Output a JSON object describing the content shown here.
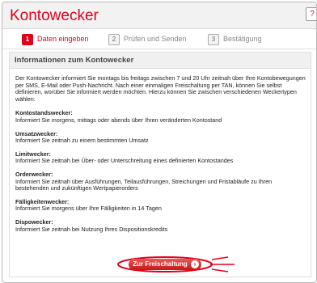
{
  "window": {
    "title": "Kontowecker",
    "help_label": "?"
  },
  "steps": [
    {
      "number": "1",
      "label": "Daten eingeben",
      "active": true
    },
    {
      "number": "2",
      "label": "Prüfen und Senden",
      "active": false
    },
    {
      "number": "3",
      "label": "Bestätigung",
      "active": false
    }
  ],
  "section": {
    "heading": "Informationen zum Kontowecker",
    "intro": "Der Kontowecker informiert Sie montags bis freitags zwischen 7 und 20 Uhr zeitnah über Ihre Kontobewegungen per SMS, E-Mail oder Push-Nachricht. Nach einer einmaligen Freischaltung per TAN, können Sie selbst definieren, worüber Sie informiert werden möchten. Hierzu können Sie zwischen verschiedenen Weckertypen wählen:",
    "items": [
      {
        "title": "Kontostandswecker:",
        "desc": "Informiert Sie morgens, mittags oder abends über Ihren veränderten Kontostand"
      },
      {
        "title": "Umsatzwecker:",
        "desc": "Informiert Sie zeitnah zu einem bestimmten Umsatz"
      },
      {
        "title": "Limitwecker:",
        "desc": "Informiert Sie zeitnah bei Über- oder Unterschreitung eines definierten Kontostandes"
      },
      {
        "title": "Orderwecker:",
        "desc": "Informiert Sie zeitnah über Ausführungen, Teilausführungen, Streichungen und Fristabläufe zu Ihren bestehenden und zukünftigen Wertpapierorders"
      },
      {
        "title": "Fälligkeitenwecker:",
        "desc": "Informiert Sie morgens über Ihre Fälligkeiten in 14 Tagen"
      },
      {
        "title": "Dispowecker:",
        "desc": "Informiert Sie zeitnah bei Nutzung Ihres Dispositionskredits"
      }
    ]
  },
  "button": {
    "label": "Zur Freischaltung",
    "arrow": "›"
  },
  "colors": {
    "brand": "#e2001a"
  }
}
